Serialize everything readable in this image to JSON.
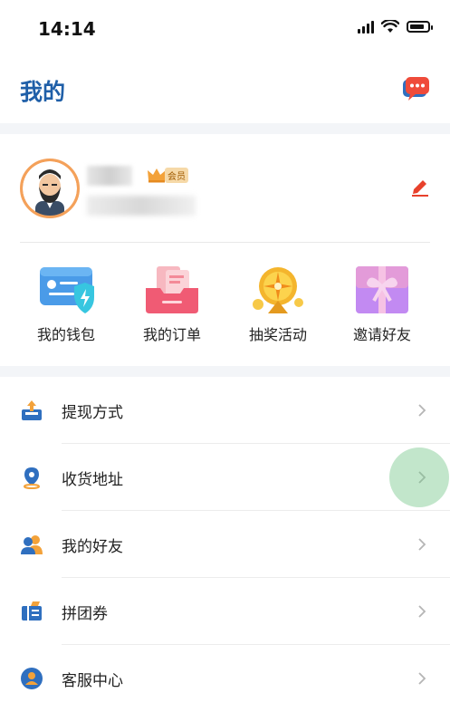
{
  "status_bar": {
    "time": "14:14"
  },
  "header": {
    "title": "我的"
  },
  "profile": {
    "vip_badge": "会员"
  },
  "quick_actions": [
    {
      "label": "我的钱包",
      "icon": "wallet-icon"
    },
    {
      "label": "我的订单",
      "icon": "order-icon"
    },
    {
      "label": "抽奖活动",
      "icon": "lottery-wheel-icon"
    },
    {
      "label": "邀请好友",
      "icon": "gift-icon"
    }
  ],
  "menu": [
    {
      "label": "提现方式",
      "icon": "withdraw-icon"
    },
    {
      "label": "收货地址",
      "icon": "location-icon"
    },
    {
      "label": "我的好友",
      "icon": "friends-icon"
    },
    {
      "label": "拼团券",
      "icon": "coupon-icon"
    },
    {
      "label": "客服中心",
      "icon": "customer-service-icon"
    }
  ],
  "colors": {
    "accent": "#1f5fa8",
    "edit": "#e8412c",
    "message": "#e8412c",
    "vip": "#f6d9a8"
  }
}
